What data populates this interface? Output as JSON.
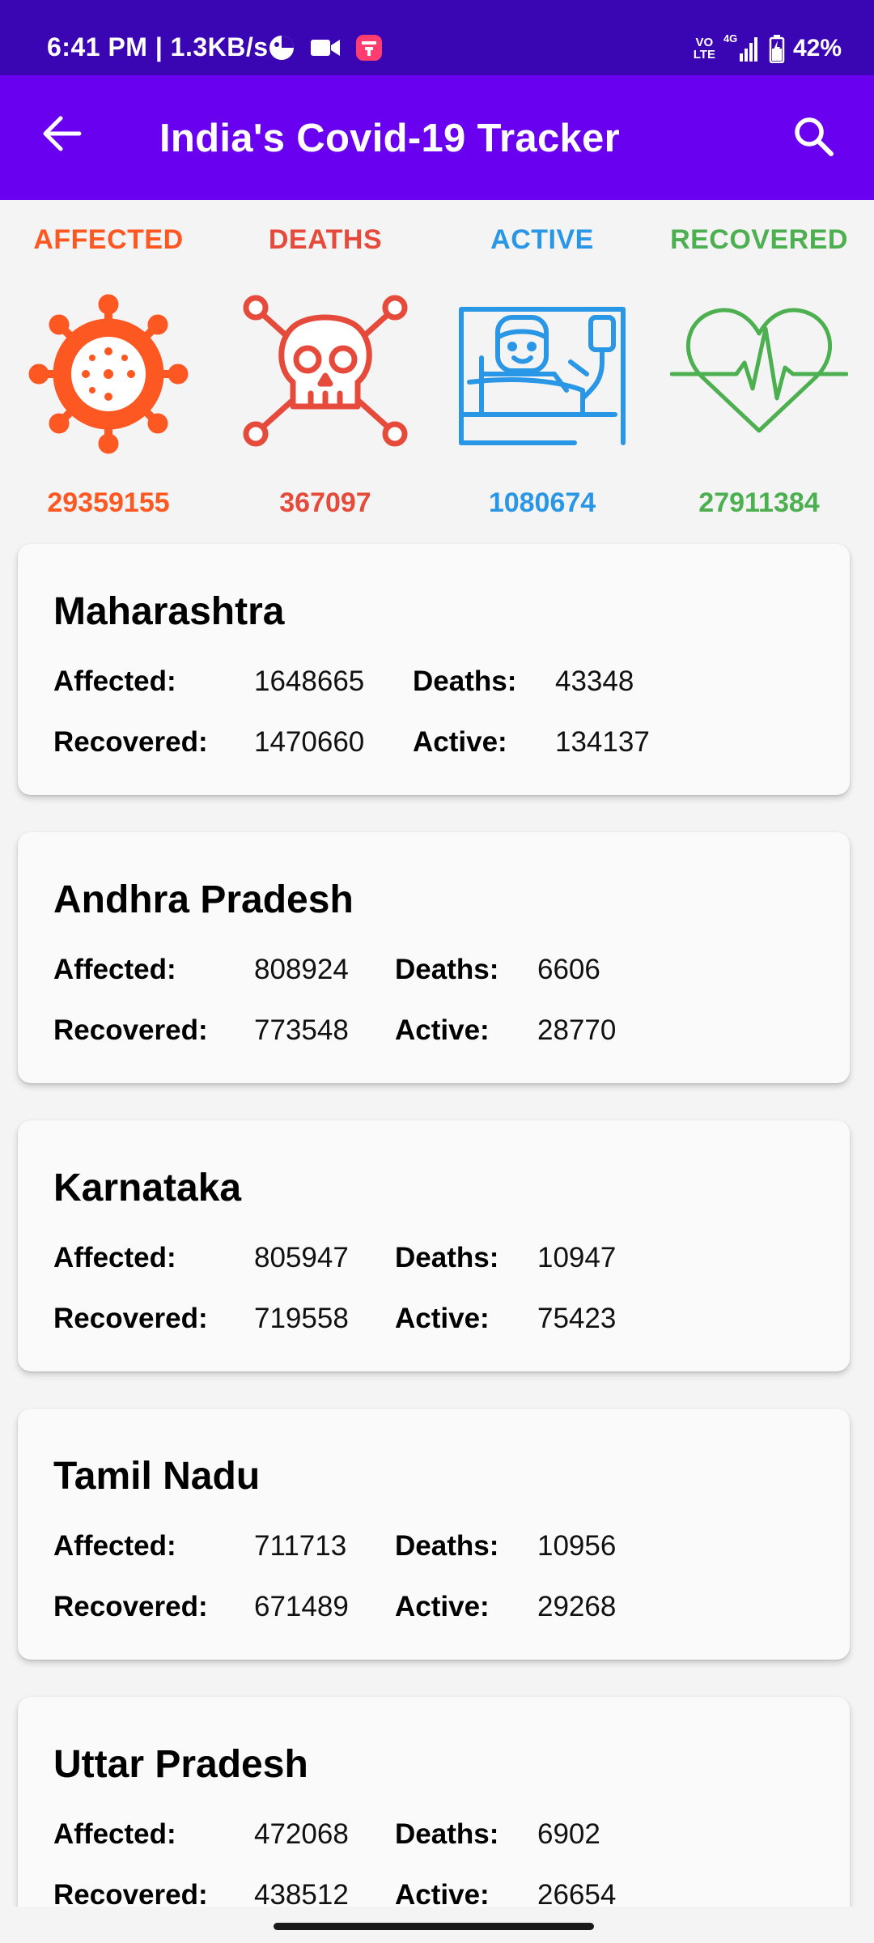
{
  "status_bar": {
    "time": "6:41 PM | 1.3KB/s",
    "network_top": "VO",
    "network_bottom": "LTE",
    "signal": "4G",
    "battery": "42%"
  },
  "app_bar": {
    "title": "India's Covid-19 Tracker",
    "back_icon": "arrow-left-icon",
    "search_icon": "search-icon"
  },
  "summary": [
    {
      "label": "AFFECTED",
      "value": "29359155",
      "color": "#fd5722",
      "icon": "virus-icon"
    },
    {
      "label": "DEATHS",
      "value": "367097",
      "color": "#e64a3b",
      "icon": "skull-crossbones-icon"
    },
    {
      "label": "ACTIVE",
      "value": "1080674",
      "color": "#2a96e6",
      "icon": "patient-bed-icon"
    },
    {
      "label": "RECOVERED",
      "value": "27911384",
      "color": "#4caf50",
      "icon": "heartbeat-icon"
    }
  ],
  "labels": {
    "affected": "Affected:",
    "deaths": "Deaths:",
    "recovered": "Recovered:",
    "active": "Active:"
  },
  "states": [
    {
      "name": "Maharashtra",
      "affected": "1648665",
      "deaths": "43348",
      "recovered": "1470660",
      "active": "134137"
    },
    {
      "name": "Andhra Pradesh",
      "affected": "808924",
      "deaths": "6606",
      "recovered": "773548",
      "active": "28770"
    },
    {
      "name": "Karnataka",
      "affected": "805947",
      "deaths": "10947",
      "recovered": "719558",
      "active": "75423"
    },
    {
      "name": "Tamil Nadu",
      "affected": "711713",
      "deaths": "10956",
      "recovered": "671489",
      "active": "29268"
    },
    {
      "name": "Uttar Pradesh",
      "affected": "472068",
      "deaths": "6902",
      "recovered": "438512",
      "active": "26654"
    }
  ]
}
